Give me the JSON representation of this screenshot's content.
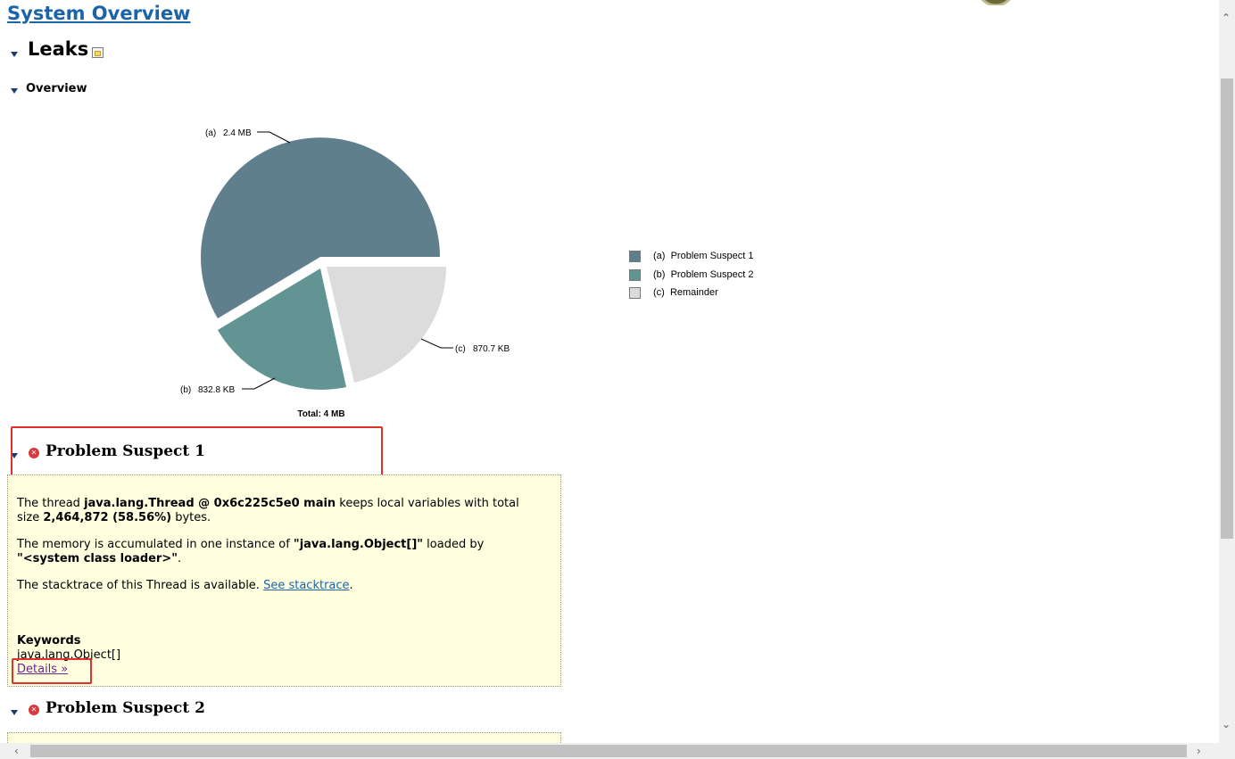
{
  "title": "System Overview",
  "leaks_heading": "Leaks",
  "overview_heading": "Overview",
  "chart_data": {
    "type": "pie",
    "slices": [
      {
        "label": "(a)",
        "value_text": "2.4 MB",
        "value": 2.4,
        "legend": "Problem Suspect 1",
        "color": "#5f7f8d"
      },
      {
        "label": "(b)",
        "value_text": "832.8 KB",
        "value": 0.8328,
        "legend": "Problem Suspect 2",
        "color": "#629494"
      },
      {
        "label": "(c)",
        "value_text": "870.7 KB",
        "value": 0.8707,
        "legend": "Remainder",
        "color": "#dcdcdc"
      }
    ],
    "total": "Total: 4 MB"
  },
  "suspects": [
    {
      "heading": "Problem Suspect 1",
      "p1": {
        "pre": "The thread ",
        "b1": "java.lang.Thread @ 0x6c225c5e0 main",
        "mid": " keeps local variables with total",
        "mid2": "size ",
        "b2": "2,464,872 (58.56%)",
        "post": " bytes."
      },
      "p2": {
        "pre": "The memory is accumulated in one instance of ",
        "b1": "\"java.lang.Object[]\"",
        "mid": " loaded by",
        "b2": "\"<system class loader>\"",
        "post": "."
      },
      "p3": {
        "pre": "The stacktrace of this Thread is available. ",
        "link": "See stacktrace",
        "post": "."
      },
      "keywords_label": "Keywords",
      "keywords_value": "java.lang.Object[]",
      "details_link": "Details »"
    },
    {
      "heading": "Problem Suspect 2"
    }
  ]
}
